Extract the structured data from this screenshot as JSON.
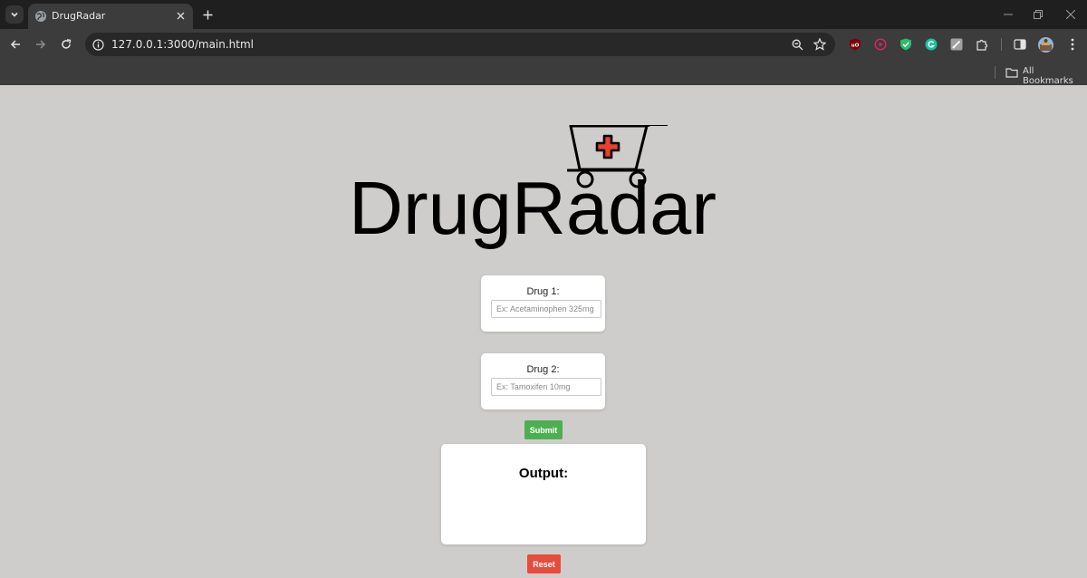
{
  "browser": {
    "tab": {
      "title": "DrugRadar"
    },
    "address": {
      "url": "127.0.0.1:3000/main.html"
    },
    "bookmarks": {
      "all_label": "All Bookmarks"
    },
    "icons": [
      "tab-search-icon",
      "globe-icon",
      "close-icon",
      "plus-icon",
      "back-icon",
      "forward-icon",
      "reload-icon",
      "site-info-icon",
      "zoom-icon",
      "star-icon",
      "ublock-icon",
      "screen-recorder-icon",
      "shield-icon",
      "grammarly-icon",
      "notes-icon",
      "extensions-icon",
      "side-panel-icon",
      "avatar",
      "more-icon",
      "folder-icon",
      "minimize-icon",
      "restore-icon",
      "window-close-icon"
    ]
  },
  "page": {
    "logo": {
      "text": "DrugRadar",
      "cross_color": "#e8412f"
    },
    "drug1": {
      "label": "Drug 1:",
      "placeholder": "Ex: Acetaminophen 325mg",
      "value": ""
    },
    "drug2": {
      "label": "Drug 2:",
      "placeholder": "Ex: Tamoxifen 10mg",
      "value": ""
    },
    "submit": {
      "label": "Submit",
      "color": "#4caf50"
    },
    "output": {
      "title": "Output:",
      "content": ""
    },
    "reset": {
      "label": "Reset",
      "color": "#e74c3c"
    }
  }
}
